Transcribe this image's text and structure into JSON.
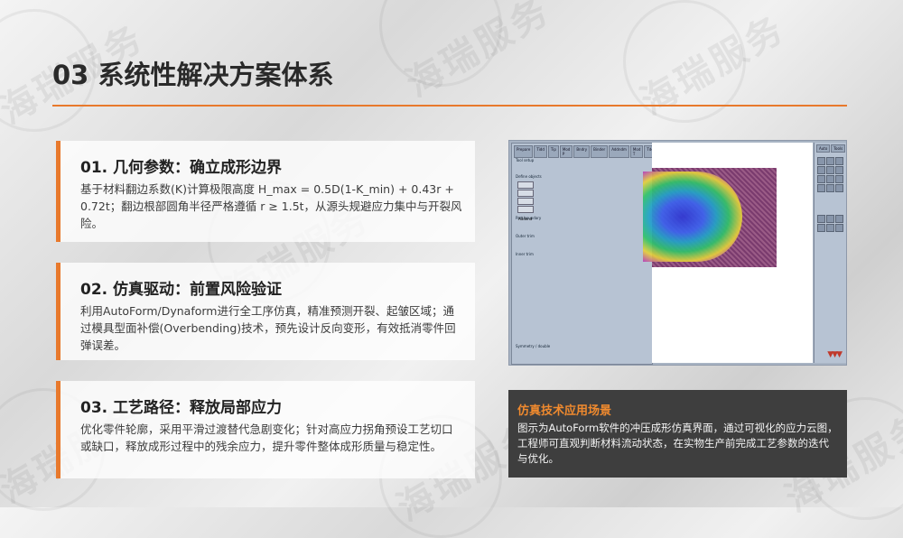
{
  "page": {
    "title": "03 系统性解决方案体系"
  },
  "watermark": "海瑞服务",
  "cards": [
    {
      "heading": "01. 几何参数：确立成形边界",
      "body": "基于材料翻边系数(K)计算极限高度 H_max = 0.5D(1-K_min) + 0.43r + 0.72t；翻边根部圆角半径严格遵循 r ≥ 1.5t，从源头规避应力集中与开裂风险。"
    },
    {
      "heading": "02. 仿真驱动：前置风险验证",
      "body": "利用AutoForm/Dynaform进行全工序仿真，精准预测开裂、起皱区域；通过模具型面补偿(Overbending)技术，预先设计反向变形，有效抵消零件回弹误差。"
    },
    {
      "heading": "03. 工艺路径：释放局部应力",
      "body": "优化零件轮廓，采用平滑过渡替代急剧变化；针对高应力拐角预设工艺切口或缺口，释放成形过程中的残余应力，提升零件整体成形质量与稳定性。"
    }
  ],
  "screenshot": {
    "tabs": [
      "Prepare",
      "Tidd",
      "Tip",
      "Mod P",
      "Bndry",
      "Binder",
      "Addndm",
      "Mod T",
      "Tdes"
    ],
    "rows": [
      "Tool setup",
      "Define objects",
      "Part boundary",
      "Outer trim",
      "Inner trim",
      "Symmetry / double"
    ],
    "buttons": [
      "Part",
      "Binder",
      "Flange",
      "Addend"
    ],
    "right_tabs": [
      "Auto",
      "Tools"
    ]
  },
  "note": {
    "title": "仿真技术应用场景",
    "body": "图示为AutoForm软件的冲压成形仿真界面，通过可视化的应力云图，工程师可直观判断材料流动状态，在实物生产前完成工艺参数的迭代与优化。"
  },
  "colors": {
    "accent": "#e8792c",
    "note_bg": "#3e3e3e",
    "note_title": "#f08a2e"
  }
}
